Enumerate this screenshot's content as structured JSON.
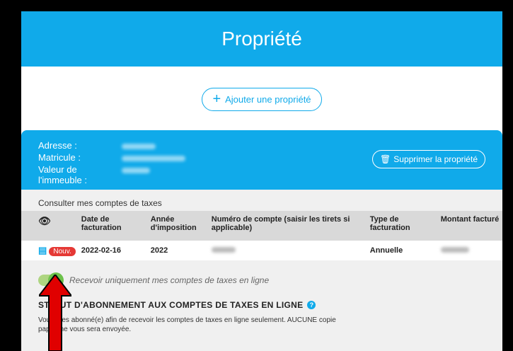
{
  "page": {
    "title": "Propriété"
  },
  "actions": {
    "add_label": "Ajouter une propriété",
    "delete_label": "Supprimer la propriété"
  },
  "property": {
    "address_label": "Adresse :",
    "matricule_label": "Matricule :",
    "value_label": "Valeur de l'immeuble :"
  },
  "bills": {
    "heading": "Consulter mes comptes de taxes",
    "columns": [
      "Date de facturation",
      "Année d'imposition",
      "Numéro de compte (saisir les tirets si applicable)",
      "Type de facturation",
      "Montant facturé"
    ],
    "rows": [
      {
        "badge": "Nouv.",
        "date": "2022-02-16",
        "year": "2022",
        "type": "Annuelle"
      }
    ]
  },
  "toggle": {
    "label": "Recevoir uniquement mes comptes de taxes en ligne",
    "on": true
  },
  "status": {
    "title": "STATUT D'ABONNEMENT AUX COMPTES DE TAXES EN LIGNE",
    "text": "Vous êtes abonné(e) afin de recevoir les comptes de taxes en ligne seulement. AUCUNE copie papier ne vous sera envoyée."
  },
  "colors": {
    "accent": "#10aaea",
    "badge": "#e53935",
    "toggle": "#6cc14b",
    "arrow": "#e00000"
  }
}
